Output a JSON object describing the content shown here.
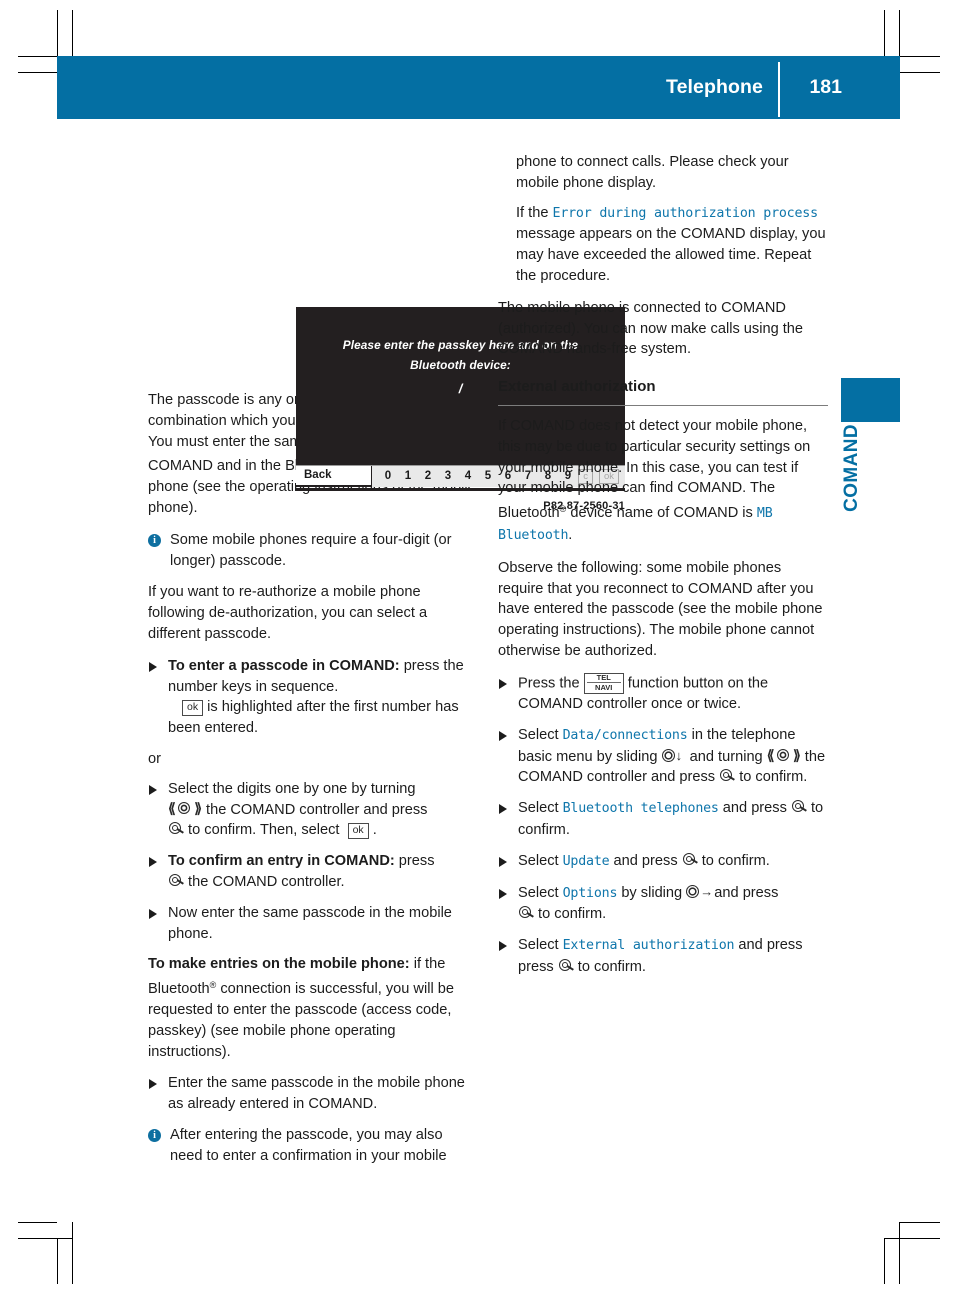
{
  "header": {
    "title": "Telephone",
    "page_number": "181",
    "accent_color": "#046FA3"
  },
  "chapter_tab": {
    "label": "COMAND"
  },
  "figure": {
    "prompt_line1": "Please enter the passkey here and on the",
    "prompt_line2": "Bluetooth device:",
    "entry_cursor": "/",
    "back_label": "Back",
    "digits": [
      "0",
      "1",
      "2",
      "3",
      "4",
      "5",
      "6",
      "7",
      "8",
      "9"
    ],
    "clear_key": "c",
    "ok_key": "ok",
    "caption": "P82.87-2560-31"
  },
  "left_column": {
    "para_passcode_1": "The passcode is any one to sixteen-digit number combination which you can determine yourself. You must enter the same number combination in COMAND and in the Bluetooth",
    "para_passcode_2": "-capable mobile phone (see the operating instructions of the mobile phone).",
    "note_four_digit": "Some mobile phones require a four-digit (or longer) passcode.",
    "para_reauthorize": "If you want to re-authorize a mobile phone following de-authorization, you can select a different passcode.",
    "step_enter_passcode_bold": "To enter a passcode in COMAND:",
    "step_enter_passcode_rest": " press the number keys in sequence.",
    "step_enter_passcode_sub_rest": " is highlighted after the first number has been entered.",
    "or_label": "or",
    "step_select_digits_a": "Select the digits one by one by turning",
    "step_select_digits_b": " the COMAND controller and press",
    "step_select_digits_c": " to confirm. Then, select",
    "step_select_digits_d": ".",
    "step_confirm_bold": "To confirm an entry in COMAND:",
    "step_confirm_rest": " press",
    "step_confirm_rest2": " the COMAND controller.",
    "step_now_enter": "Now enter the same passcode in the mobile phone.",
    "para_mobile_entries_bold": "To make entries on the mobile phone:",
    "para_mobile_entries_rest_1": " if the Bluetooth",
    "para_mobile_entries_rest_2": " connection is successful, you will be requested to enter the passcode (access code, passkey) (see mobile phone operating instructions).",
    "step_enter_same": "Enter the same passcode in the mobile phone as already entered in COMAND.",
    "note_confirmation": "After entering the passcode, you may also need to enter a confirmation in your mobile"
  },
  "right_column": {
    "para_continued": "phone to connect calls. Please check your mobile phone display.",
    "para_error_pre": "If the ",
    "para_error_ui": "Error during authorization process",
    "para_error_post": " message appears on the COMAND display, you may have exceeded the allowed time. Repeat the procedure.",
    "para_connected": "The mobile phone is connected to COMAND (authorized). You can now make calls using the COMAND hands-free system.",
    "subhead_external": "External authorization",
    "para_external_1": "If COMAND does not detect your mobile phone, this may be due to particular security settings on your mobile phone. In this case, you can test if your mobile phone can find COMAND. The Bluetooth",
    "para_external_2": " device name of COMAND is ",
    "para_external_ui": "MB Bluetooth",
    "para_external_3": ".",
    "para_observe": "Observe the following: some mobile phones require that you reconnect to COMAND after you have entered the passcode (see the mobile phone operating instructions). The mobile phone cannot otherwise be authorized.",
    "step_press_tel_a": "Press the",
    "step_press_tel_key_line1": "TEL",
    "step_press_tel_key_line2": "NAVI",
    "step_press_tel_b": " function button on the COMAND controller once or twice.",
    "step_data_a": "Select ",
    "step_data_ui": "Data/connections",
    "step_data_b": " in the telephone basic menu by sliding",
    "step_data_c": " and turning",
    "step_data_d": " the COMAND controller and press",
    "step_data_e": " to confirm.",
    "step_bt_a": "Select ",
    "step_bt_ui": "Bluetooth telephones",
    "step_bt_b": " and press",
    "step_bt_c": " to confirm.",
    "step_update_a": "Select ",
    "step_update_ui": "Update",
    "step_update_b": " and press",
    "step_update_c": " to confirm.",
    "step_options_a": "Select ",
    "step_options_ui": "Options",
    "step_options_b": " by sliding",
    "step_options_c": " and press",
    "step_options_d": " to confirm.",
    "step_extauth_a": "Select ",
    "step_extauth_ui": "External authorization",
    "step_extauth_b": " and press",
    "step_extauth_c": " to confirm."
  }
}
